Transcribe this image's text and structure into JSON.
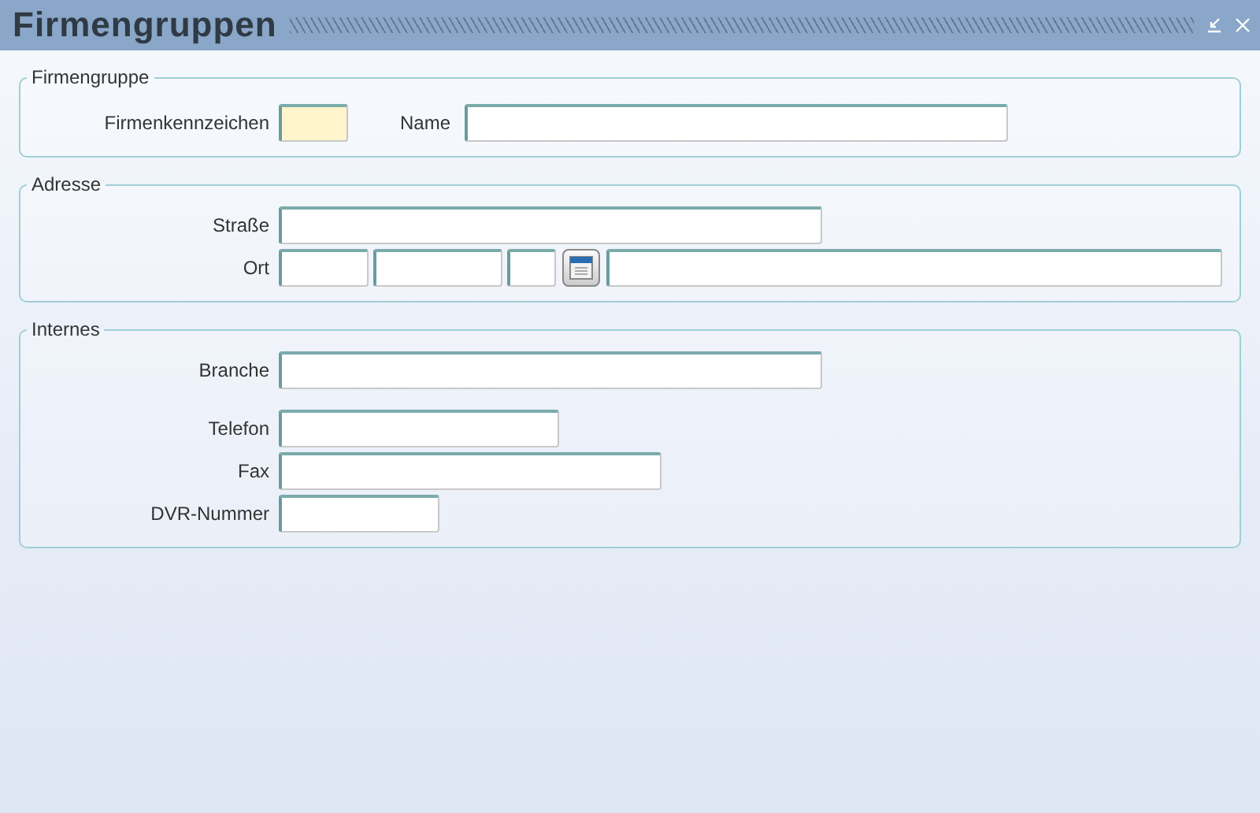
{
  "window": {
    "title": "Firmengruppen"
  },
  "sections": [
    {
      "legend": "Firmengruppe",
      "rows": [
        {
          "items": [
            {
              "kind": "label",
              "text": "Firmenkennzeichen"
            },
            {
              "kind": "input",
              "highlighted": true
            },
            {
              "kind": "label",
              "text": "Name"
            },
            {
              "kind": "input",
              "highlighted": false
            }
          ]
        }
      ]
    },
    {
      "legend": "Adresse",
      "rows": [
        {
          "items": [
            {
              "kind": "label",
              "text": "Straße"
            },
            {
              "kind": "input",
              "highlighted": false
            }
          ]
        },
        {
          "items": [
            {
              "kind": "label",
              "text": "Ort"
            },
            {
              "kind": "input",
              "highlighted": false
            },
            {
              "kind": "input",
              "highlighted": false
            },
            {
              "kind": "input",
              "highlighted": false
            },
            {
              "kind": "lookup"
            },
            {
              "kind": "input",
              "highlighted": false
            }
          ]
        }
      ]
    },
    {
      "legend": "Internes",
      "rows": [
        {
          "items": [
            {
              "kind": "label",
              "text": "Branche"
            },
            {
              "kind": "input",
              "highlighted": false
            }
          ]
        },
        {
          "items": [
            {
              "kind": "label",
              "text": "Telefon"
            },
            {
              "kind": "input",
              "highlighted": false
            }
          ]
        },
        {
          "items": [
            {
              "kind": "label",
              "text": "Fax"
            },
            {
              "kind": "input",
              "highlighted": false
            }
          ]
        },
        {
          "items": [
            {
              "kind": "label",
              "text": "DVR-Nummer"
            },
            {
              "kind": "input",
              "highlighted": false
            }
          ]
        }
      ]
    }
  ]
}
